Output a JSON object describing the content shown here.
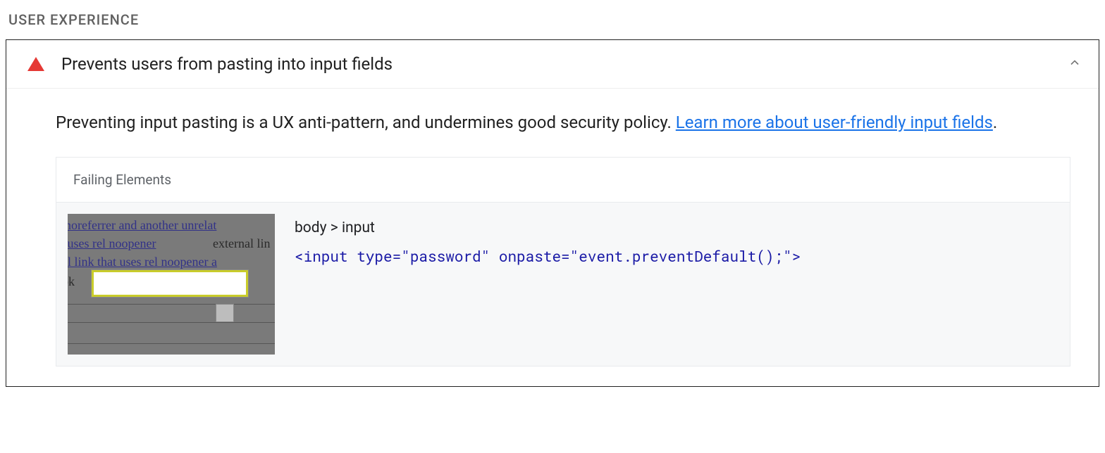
{
  "section": {
    "title": "USER EXPERIENCE"
  },
  "audit": {
    "title": "Prevents users from pasting into input fields",
    "description_text": "Preventing input pasting is a UX anti-pattern, and undermines good security policy. ",
    "link_text": "Learn more about user-friendly input fields",
    "period": "."
  },
  "failing": {
    "header": "Failing Elements",
    "selector": "body > input",
    "code": "<input type=\"password\" onpaste=\"event.preventDefault();\">"
  },
  "thumb": {
    "l1": " noreferrer and another unrelat",
    "l2": "t uses rel noopener",
    "l2b": "external lin",
    "l3": "al link that uses rel noopener a",
    "l4": " ok"
  }
}
